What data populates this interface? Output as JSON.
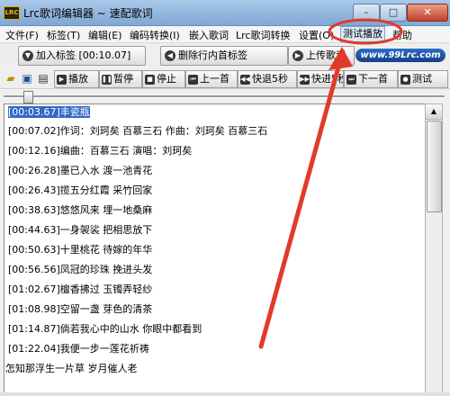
{
  "window": {
    "title": "Lrc歌词编辑器 ~ 速配歌词",
    "app_icon_text": "LRC",
    "min_glyph": "–",
    "max_glyph": "□",
    "close_glyph": "✕"
  },
  "menu": [
    "文件(F)",
    "标签(T)",
    "编辑(E)",
    "编码转换(I)",
    "嵌入歌词",
    "Lrc歌词转换",
    "设置(O)",
    "测试播放",
    "帮助"
  ],
  "toolbar1": {
    "add_tag": "加入标签 [00:10.07]",
    "delete_tag": "删除行内首标签",
    "upload": "上传歌词",
    "logo": "www.99Lrc.com"
  },
  "toolbar2": {
    "play": "播放",
    "pause": "暂停",
    "stop": "停止",
    "prev": "上一首",
    "rewind": "快退5秒",
    "forward": "快进5秒",
    "next": "下一首",
    "test": "测试"
  },
  "lyrics": [
    {
      "ts": "[00:03.67]",
      "text": "丰瓷瓶"
    },
    {
      "ts": "[00:07.02]",
      "text": "作词：刘珂矣 百慕三石 作曲：刘珂矣 百慕三石"
    },
    {
      "ts": "[00:12.16]",
      "text": "编曲：百慕三石 演唱：刘珂矣"
    },
    {
      "ts": "[00:26.28]",
      "text": "墨已入水 渡一池青花"
    },
    {
      "ts": "[00:26.43]",
      "text": "揽五分红霞 采竹回家"
    },
    {
      "ts": "[00:38.63]",
      "text": "悠悠风来 埋一地桑麻"
    },
    {
      "ts": "[00:44.63]",
      "text": "一身袈裟 把相思放下"
    },
    {
      "ts": "[00:50.63]",
      "text": "十里桃花 待嫁的年华"
    },
    {
      "ts": "[00:56.56]",
      "text": "凤冠的珍珠 挽进头发"
    },
    {
      "ts": "[01:02.67]",
      "text": "檀香拂过 玉镯弄轻纱"
    },
    {
      "ts": "[01:08.98]",
      "text": "空留一盏 芽色的清茶"
    },
    {
      "ts": "[01:14.87]",
      "text": "倘若我心中的山水 你眼中都看到"
    },
    {
      "ts": "[01:22.04]",
      "text": "我便一步一莲花祈祷"
    },
    {
      "ts": "",
      "text": "怎知那浮生一片草 岁月催人老"
    }
  ]
}
